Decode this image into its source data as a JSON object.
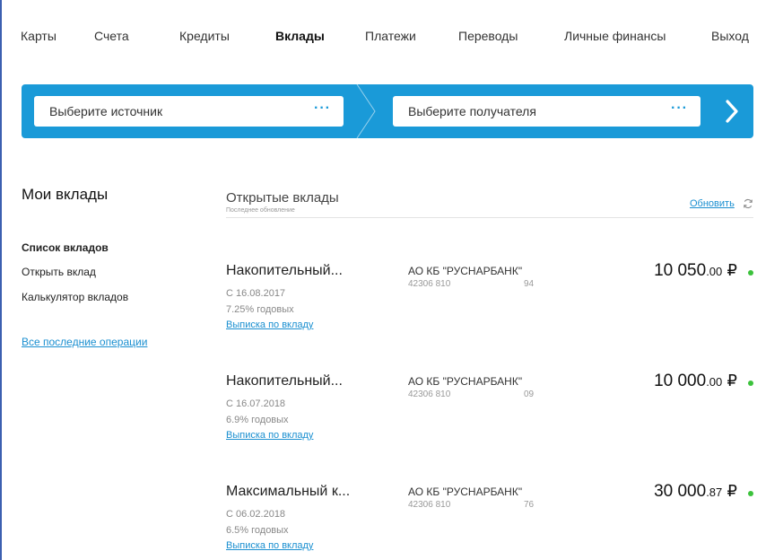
{
  "nav": {
    "items": [
      {
        "label": "Карты"
      },
      {
        "label": "Счета"
      },
      {
        "label": "Кредиты"
      },
      {
        "label": "Вклады"
      },
      {
        "label": "Платежи"
      },
      {
        "label": "Переводы"
      },
      {
        "label": "Личные финансы"
      },
      {
        "label": "Выход"
      }
    ],
    "active": "Вклады"
  },
  "transfer": {
    "source_placeholder": "Выберите источник",
    "target_placeholder": "Выберите получателя",
    "dots": "···"
  },
  "sidebar": {
    "title": "Мои вклады",
    "links": [
      {
        "label": "Список вкладов",
        "active": true
      },
      {
        "label": "Открыть вклад",
        "active": false
      },
      {
        "label": "Калькулятор вкладов",
        "active": false
      }
    ],
    "all_ops": "Все последние операции"
  },
  "main": {
    "title": "Открытые вклады",
    "subtitle": "Последнее обновление",
    "refresh": "Обновить"
  },
  "deposits": [
    {
      "name": "Накопительный...",
      "date": "С 16.08.2017",
      "rate": "7.25% годовых",
      "statement": "Выписка по вкладу",
      "bank": "АО КБ \"РУСНАРБАНК\"",
      "acc_prefix": "42306 810",
      "acc_suffix": "94",
      "amount_int": "10 050",
      "amount_frac": ".00",
      "currency": "₽"
    },
    {
      "name": "Накопительный...",
      "date": "С 16.07.2018",
      "rate": "6.9% годовых",
      "statement": "Выписка по вкладу",
      "bank": "АО КБ \"РУСНАРБАНК\"",
      "acc_prefix": "42306 810",
      "acc_suffix": "09",
      "amount_int": "10 000",
      "amount_frac": ".00",
      "currency": "₽"
    },
    {
      "name": "Максимальный к...",
      "date": "С 06.02.2018",
      "rate": "6.5% годовых",
      "statement": "Выписка по вкладу",
      "bank": "АО КБ \"РУСНАРБАНК\"",
      "acc_prefix": "42306 810",
      "acc_suffix": "76",
      "amount_int": "30 000",
      "amount_frac": ".87",
      "currency": "₽"
    }
  ],
  "colors": {
    "accent": "#1a9ad8",
    "link": "#1a8fd0",
    "status_ok": "#3cc23c"
  }
}
